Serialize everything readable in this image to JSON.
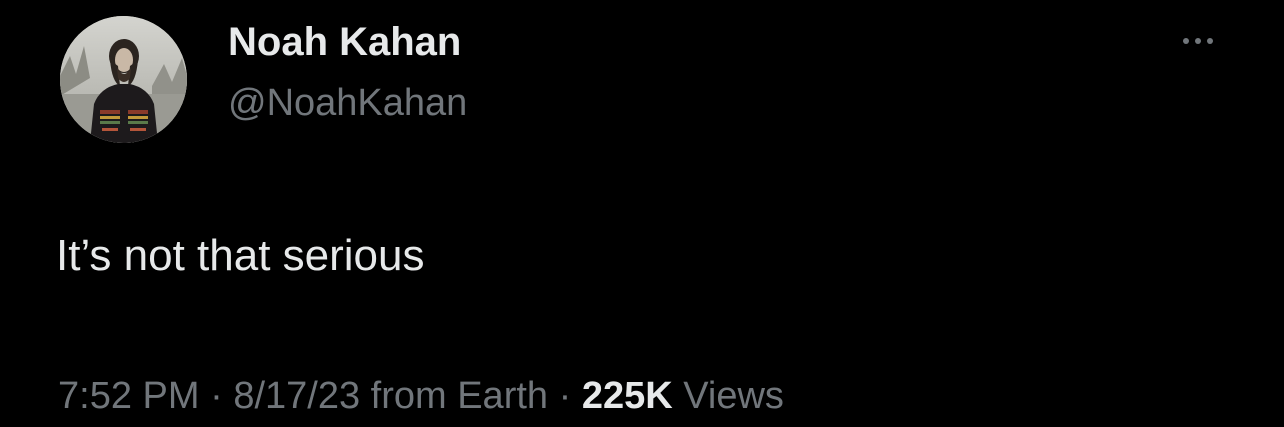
{
  "author": {
    "display_name": "Noah Kahan",
    "handle": "@NoahKahan",
    "avatar_icon": "profile-photo"
  },
  "menu": {
    "icon": "more-horizontal-icon"
  },
  "tweet": {
    "text": "It’s not that serious"
  },
  "meta": {
    "time": "7:52 PM",
    "separator": "·",
    "date_source": "8/17/23 from Earth",
    "views_count": "225K",
    "views_label": "Views"
  },
  "colors": {
    "background": "#000000",
    "primary_text": "#e7e9ea",
    "secondary_text": "#71767b"
  }
}
